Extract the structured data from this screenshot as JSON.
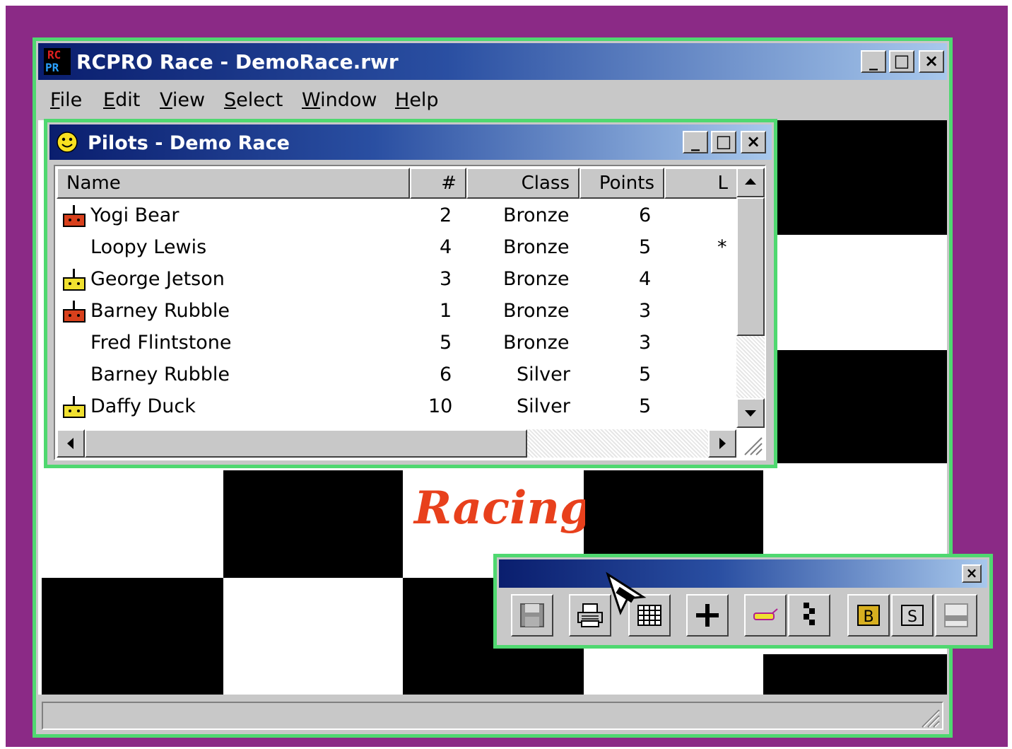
{
  "app": {
    "title": "RCPRO Race - DemoRace.rwr",
    "logo_text_top": "RC",
    "logo_text_bottom": "PR",
    "window_buttons": [
      "_",
      "□",
      "×"
    ]
  },
  "menu": {
    "items": [
      {
        "accel": "F",
        "rest": "ile"
      },
      {
        "accel": "E",
        "rest": "dit"
      },
      {
        "accel": "V",
        "rest": "iew"
      },
      {
        "accel": "S",
        "rest": "elect"
      },
      {
        "accel": "W",
        "rest": "indow"
      },
      {
        "accel": "H",
        "rest": "elp"
      }
    ]
  },
  "pilots_window": {
    "title": "Pilots - Demo Race",
    "columns": [
      "Name",
      "#",
      "Class",
      "Points",
      "L"
    ],
    "rows": [
      {
        "icon": "transmitter-red-icon",
        "name": "Yogi Bear",
        "num": "2",
        "class": "Bronze",
        "points": "6",
        "extra": ""
      },
      {
        "icon": "",
        "name": "Loopy Lewis",
        "num": "4",
        "class": "Bronze",
        "points": "5",
        "extra": "*"
      },
      {
        "icon": "transmitter-yellow-icon",
        "name": "George Jetson",
        "num": "3",
        "class": "Bronze",
        "points": "4",
        "extra": ""
      },
      {
        "icon": "transmitter-red-icon",
        "name": "Barney Rubble",
        "num": "1",
        "class": "Bronze",
        "points": "3",
        "extra": ""
      },
      {
        "icon": "",
        "name": "Fred Flintstone",
        "num": "5",
        "class": "Bronze",
        "points": "3",
        "extra": ""
      },
      {
        "icon": "",
        "name": "Barney Rubble",
        "num": "6",
        "class": "Silver",
        "points": "5",
        "extra": ""
      },
      {
        "icon": "transmitter-yellow-icon",
        "name": "Daffy Duck",
        "num": "10",
        "class": "Silver",
        "points": "5",
        "extra": ""
      }
    ]
  },
  "background_logo": {
    "text": "Racing",
    "color": "#e8401c"
  },
  "toolbar_window": {
    "close_label": "×",
    "buttons": [
      {
        "name": "save-icon"
      },
      {
        "name": "print-icon"
      },
      {
        "name": "grid-icon"
      },
      {
        "name": "add-icon"
      },
      {
        "name": "transponder-icon"
      },
      {
        "name": "checkered-flag-icon"
      },
      {
        "name": "bronze-icon",
        "label": "B"
      },
      {
        "name": "silver-icon",
        "label": "S"
      },
      {
        "name": "window-icon"
      }
    ]
  },
  "colors": {
    "desktop": "#8b2a86",
    "frame_accent": "#4fd870",
    "title_dark": "#0a1e6e",
    "title_light": "#a8c8ec"
  }
}
